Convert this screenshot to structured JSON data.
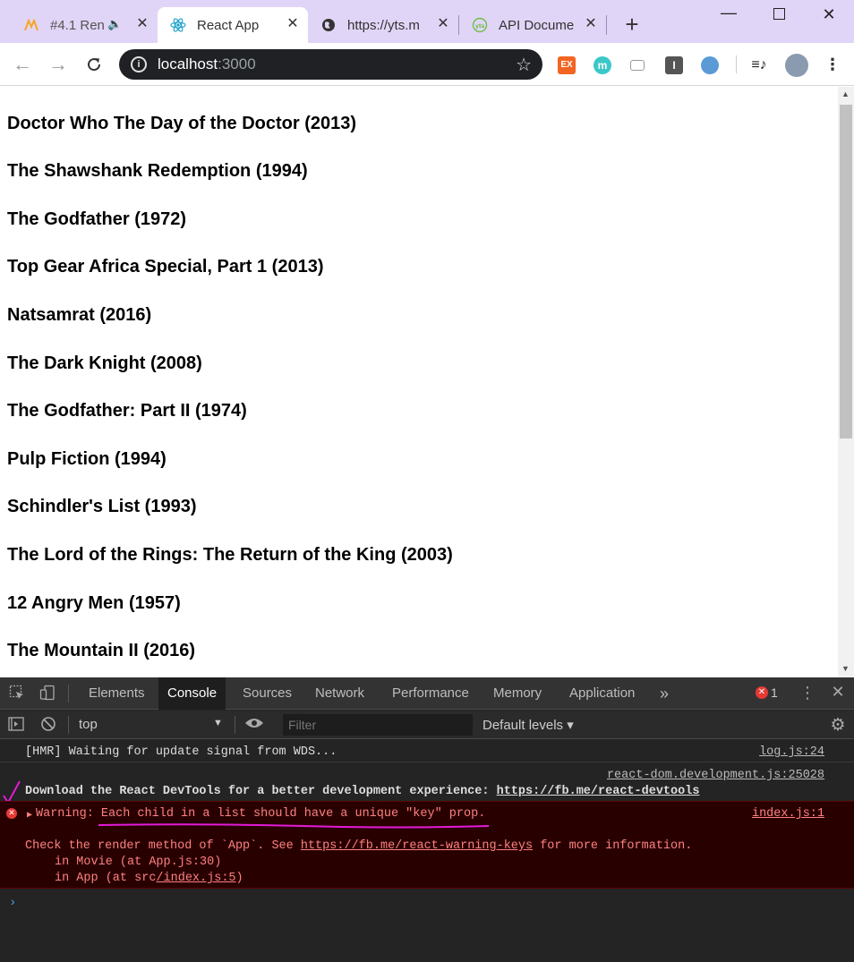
{
  "browser": {
    "tabs": [
      {
        "title": "#4.1 Ren",
        "icon": "nomad-logo-icon",
        "active": false
      },
      {
        "title": "React App",
        "icon": "react-logo-icon",
        "active": true
      },
      {
        "title": "https://yts.m",
        "icon": "globe-icon",
        "active": false
      },
      {
        "title": "API Docume",
        "icon": "yts-logo-icon",
        "active": false
      }
    ],
    "new_tab": "+",
    "url_host": "localhost",
    "url_port": ":3000"
  },
  "movies": [
    "Doctor Who The Day of the Doctor (2013)",
    "The Shawshank Redemption (1994)",
    "The Godfather (1972)",
    "Top Gear Africa Special, Part 1 (2013)",
    "Natsamrat (2016)",
    "The Dark Knight (2008)",
    "The Godfather: Part II (1974)",
    "Pulp Fiction (1994)",
    "Schindler's List (1993)",
    "The Lord of the Rings: The Return of the King (2003)",
    "12 Angry Men (1957)",
    "The Mountain II (2016)"
  ],
  "devtools": {
    "tabs": [
      "Elements",
      "Console",
      "Sources",
      "Network",
      "Performance",
      "Memory",
      "Application"
    ],
    "more": "»",
    "error_count": "1",
    "context": "top",
    "filter_placeholder": "Filter",
    "levels": "Default levels ▾",
    "console": {
      "line1": "[HMR] Waiting for update signal from WDS...",
      "line1_src": "log.js:24",
      "line2_src": "react-dom.development.js:25028",
      "line2_text": "Download the React DevTools for a better development experience: ",
      "line2_link": "https://fb.me/react-devtools",
      "warn_prefix": "Warning: ",
      "warn_text": "Each child in a list should have a unique \"key\" prop.",
      "warn_src": "index.js:1",
      "check_text": "Check the render method of `App`. See ",
      "check_link": "https://fb.me/react-warning-keys",
      "check_suffix": " for more information.",
      "stack1": "in Movie (at App.js:30)",
      "stack2_prefix": "in App (at src",
      "stack2_link": "/index.js:5",
      "stack2_suffix": ")"
    }
  },
  "colors": {
    "tabstrip": "#e1d5f7",
    "annotation": "#e31bd8",
    "error_bg": "#290000",
    "error_text": "#ff8080"
  }
}
